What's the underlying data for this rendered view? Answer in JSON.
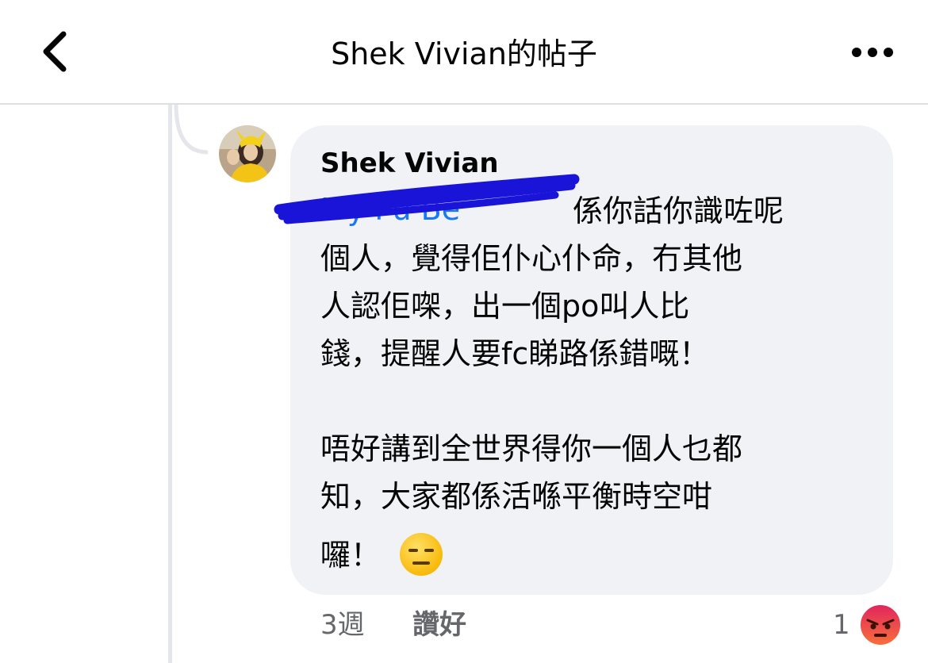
{
  "header": {
    "title": "Shek Vivian的帖子",
    "back_icon": "chevron-left-icon",
    "more_icon": "more-horizontal-icon"
  },
  "comment": {
    "author": "Shek Vivian",
    "mention": "Ivy Pu Be",
    "line1_rest": "係你話你識咗呢",
    "lines": [
      "個人，覺得佢仆心仆命，冇其他",
      "人認佢㗎，出一個po叫人比",
      "錢，提醒人要fc睇路係錯嘅！"
    ],
    "paragraph2": [
      "唔好講到全世界得你一個人乜都",
      "知，大家都係活喺平衡時空咁",
      "囉！"
    ],
    "emoji": "expressionless-face-emoji",
    "time": "3週",
    "like_label": "讚好",
    "reaction_count": "1",
    "reaction": "angry-reaction-icon"
  },
  "colors": {
    "bubble": "#f0f2f5",
    "mention": "#1877f2",
    "meta_text": "#65676b",
    "redaction": "#1a14d8",
    "angry_top": "#f9703b",
    "angry_bottom": "#e0245e"
  }
}
